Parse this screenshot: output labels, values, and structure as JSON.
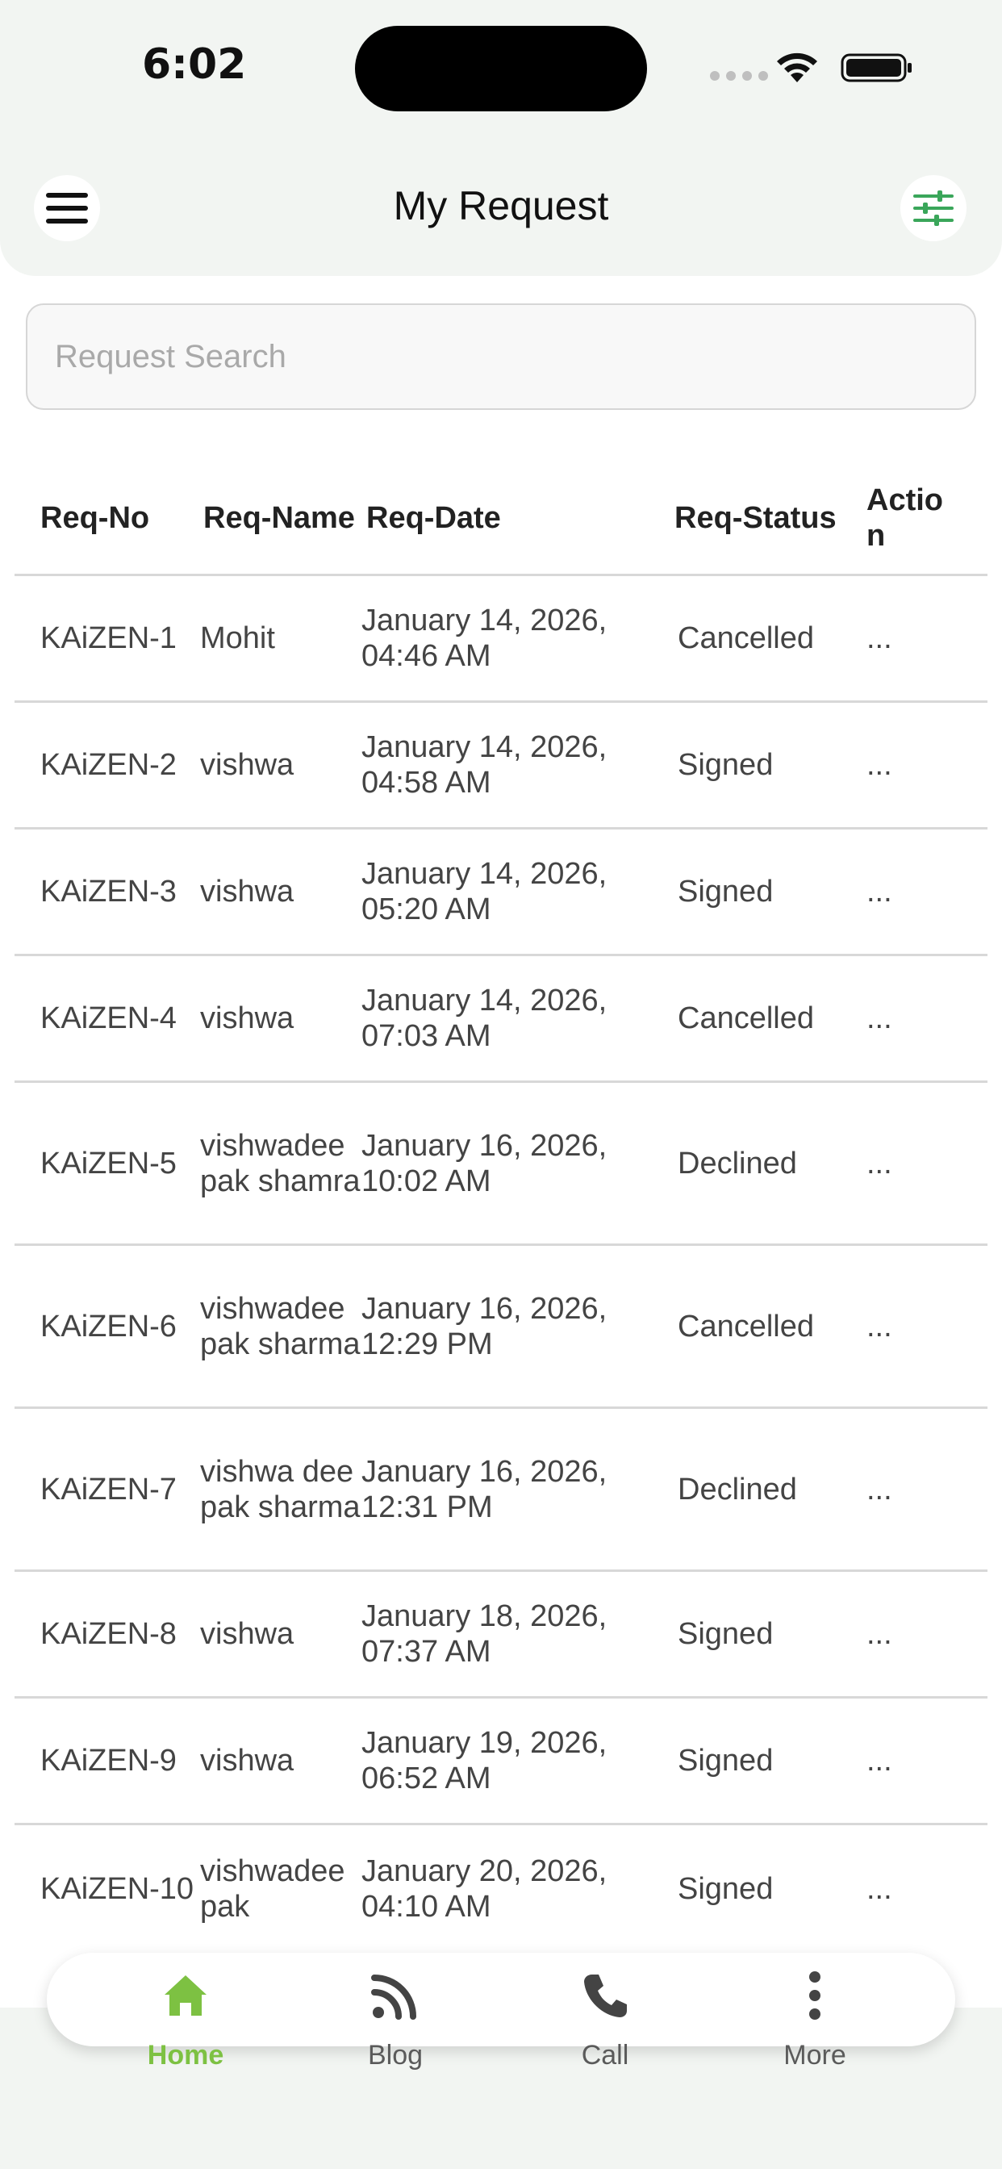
{
  "status_bar": {
    "time": "6:02"
  },
  "header": {
    "title": "My Request"
  },
  "search": {
    "placeholder": "Request Search",
    "value": ""
  },
  "table": {
    "headers": {
      "req_no": "Req-No",
      "req_name": "Req-Name",
      "req_date": "Req-Date",
      "req_status": "Req-Status",
      "action": "Action"
    },
    "rows": [
      {
        "no": "KAiZEN-1",
        "name": "Mohit",
        "date": "January 14, 2026, 04:46 AM",
        "status": "Cancelled",
        "action": "..."
      },
      {
        "no": "KAiZEN-2",
        "name": "vishwa",
        "date": "January 14, 2026, 04:58 AM",
        "status": "Signed",
        "action": "..."
      },
      {
        "no": "KAiZEN-3",
        "name": "vishwa",
        "date": "January 14, 2026, 05:20 AM",
        "status": "Signed",
        "action": "..."
      },
      {
        "no": "KAiZEN-4",
        "name": "vishwa",
        "date": "January 14, 2026, 07:03 AM",
        "status": "Cancelled",
        "action": "..."
      },
      {
        "no": "KAiZEN-5",
        "name": "vishwadeepak shamra",
        "date": "January 16, 2026, 10:02 AM",
        "status": "Declined",
        "action": "..."
      },
      {
        "no": "KAiZEN-6",
        "name": "vishwadeepak sharma",
        "date": "January 16, 2026, 12:29 PM",
        "status": "Cancelled",
        "action": "..."
      },
      {
        "no": "KAiZEN-7",
        "name": "vishwa deepak sharma",
        "date": "January 16, 2026, 12:31 PM",
        "status": "Declined",
        "action": "..."
      },
      {
        "no": "KAiZEN-8",
        "name": "vishwa",
        "date": "January 18, 2026, 07:37 AM",
        "status": "Signed",
        "action": "..."
      },
      {
        "no": "KAiZEN-9",
        "name": "vishwa",
        "date": "January 19, 2026, 06:52 AM",
        "status": "Signed",
        "action": "..."
      },
      {
        "no": "KAiZEN-10",
        "name": "vishwadeepak",
        "date": "January 20, 2026, 04:10 AM",
        "status": "Signed",
        "action": "..."
      }
    ]
  },
  "bottom_nav": {
    "items": [
      {
        "label": "Home",
        "icon": "home-icon",
        "active": true
      },
      {
        "label": "Blog",
        "icon": "rss-icon",
        "active": false
      },
      {
        "label": "Call",
        "icon": "phone-icon",
        "active": false
      },
      {
        "label": "More",
        "icon": "more-vertical-icon",
        "active": false
      }
    ]
  },
  "colors": {
    "accent": "#7dc142",
    "filter_icon": "#3aa65a",
    "header_bg": "#f2f5f2"
  }
}
